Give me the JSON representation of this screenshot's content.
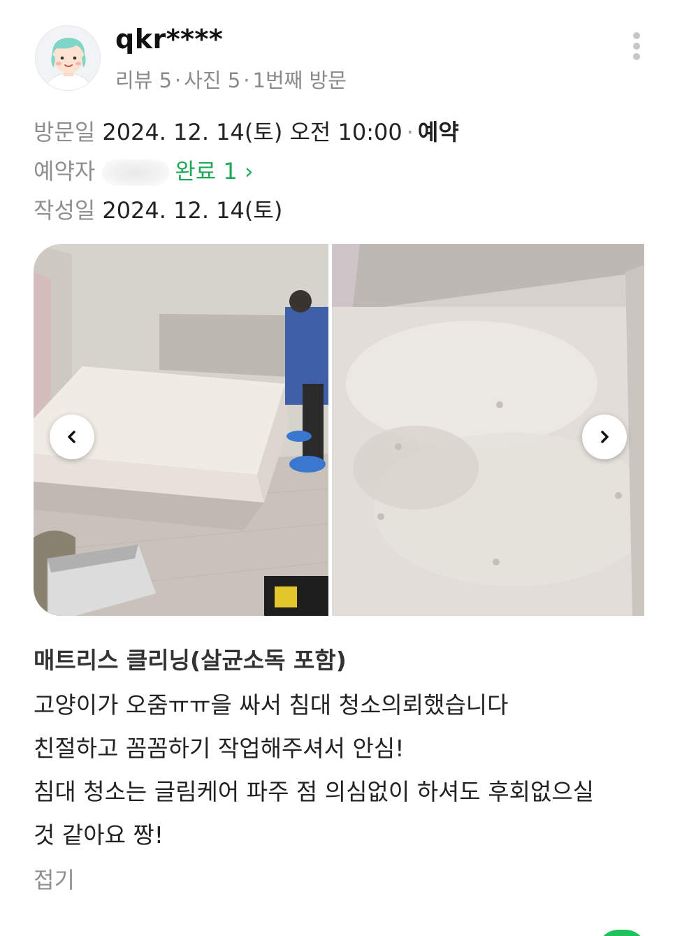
{
  "user": {
    "name": "qkr****",
    "reviews": "리뷰 5",
    "photos": "사진 5",
    "visit_count": "1번째 방문"
  },
  "icons": {
    "avatar": "avatar-icon",
    "more": "more-vertical-icon",
    "prev": "chevron-left-icon",
    "next": "chevron-right-icon"
  },
  "visit": {
    "label": "방문일",
    "value": "2024. 12. 14(토) 오전 10:00",
    "type": "예약"
  },
  "booker": {
    "label": "예약자",
    "status": "완료 1 ›"
  },
  "written": {
    "label": "작성일",
    "value": "2024. 12. 14(토)"
  },
  "photos": [
    {
      "name": "mattress-room-photo"
    },
    {
      "name": "mattress-closeup-photo"
    }
  ],
  "review": {
    "service": "매트리스 클리닝(살균소독 포함)",
    "lines": [
      "고양이가 오줌ㅠㅠ을 싸서 침대 청소의뢰했습니다",
      "친절하고 꼼꼼하기 작업해주셔서 안심!",
      "침대 청소는 글림케어 파주 점 의심없이 하셔도 후회없으실",
      "것 같아요 짱!"
    ],
    "collapse": "접기"
  },
  "colors": {
    "accent_green": "#1fa858",
    "muted_gray": "#8f8f8f"
  }
}
